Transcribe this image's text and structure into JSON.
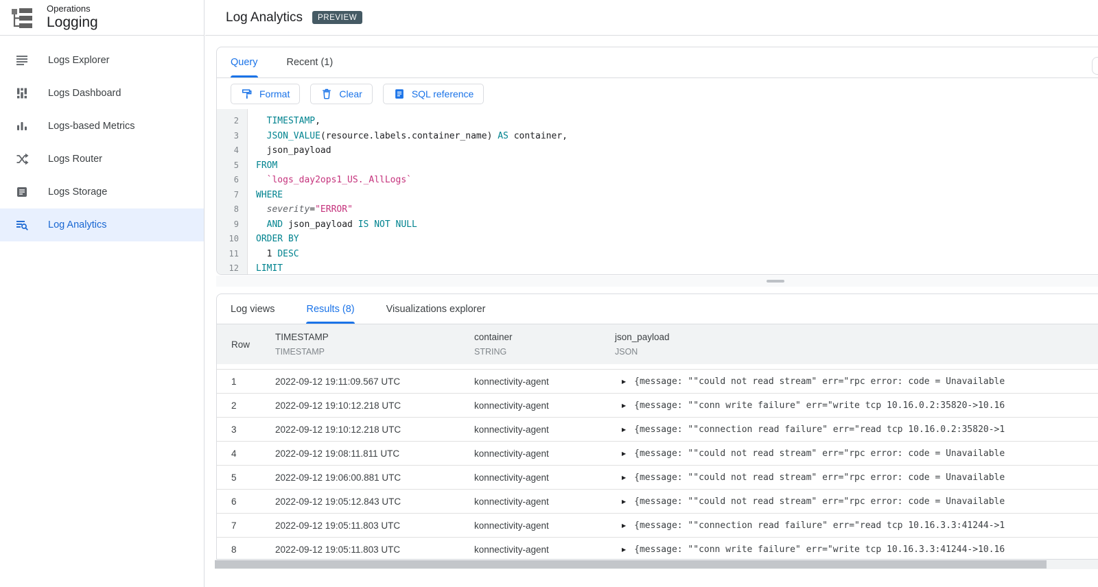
{
  "header": {
    "product": "Operations",
    "section": "Logging",
    "title": "Log Analytics",
    "badge": "PREVIEW"
  },
  "sidebar": {
    "items": [
      {
        "label": "Logs Explorer",
        "icon": "logs-explorer-icon",
        "selected": false
      },
      {
        "label": "Logs Dashboard",
        "icon": "logs-dashboard-icon",
        "selected": false
      },
      {
        "label": "Logs-based Metrics",
        "icon": "logs-based-metrics-icon",
        "selected": false
      },
      {
        "label": "Logs Router",
        "icon": "logs-router-icon",
        "selected": false
      },
      {
        "label": "Logs Storage",
        "icon": "logs-storage-icon",
        "selected": false
      },
      {
        "label": "Log Analytics",
        "icon": "log-analytics-icon",
        "selected": true
      }
    ]
  },
  "query_panel": {
    "tabs": [
      {
        "label": "Query",
        "active": true
      },
      {
        "label": "Recent (1)",
        "active": false
      }
    ],
    "toolbar": [
      {
        "label": "Format",
        "icon": "format-icon"
      },
      {
        "label": "Clear",
        "icon": "clear-icon"
      },
      {
        "label": "SQL reference",
        "icon": "sql-reference-icon"
      }
    ],
    "code_lines": [
      {
        "number": "2",
        "tokens": [
          {
            "text": "  ",
            "type": "d"
          },
          {
            "text": "TIMESTAMP",
            "type": "k"
          },
          {
            "text": ",",
            "type": "d"
          }
        ]
      },
      {
        "number": "3",
        "tokens": [
          {
            "text": "  ",
            "type": "d"
          },
          {
            "text": "JSON_VALUE",
            "type": "k"
          },
          {
            "text": "(resource.labels.container_name) ",
            "type": "d"
          },
          {
            "text": "AS",
            "type": "k"
          },
          {
            "text": " container,",
            "type": "d"
          }
        ]
      },
      {
        "number": "4",
        "tokens": [
          {
            "text": "  json_payload",
            "type": "d"
          }
        ]
      },
      {
        "number": "5",
        "tokens": [
          {
            "text": "FROM",
            "type": "k"
          }
        ]
      },
      {
        "number": "6",
        "tokens": [
          {
            "text": "  ",
            "type": "d"
          },
          {
            "text": "`logs_day2ops1_US._AllLogs`",
            "type": "s"
          }
        ]
      },
      {
        "number": "7",
        "tokens": [
          {
            "text": "WHERE",
            "type": "k"
          }
        ]
      },
      {
        "number": "8",
        "tokens": [
          {
            "text": "  ",
            "type": "d"
          },
          {
            "text": "severity",
            "type": "v"
          },
          {
            "text": "=",
            "type": "d"
          },
          {
            "text": "\"ERROR\"",
            "type": "s"
          }
        ]
      },
      {
        "number": "9",
        "tokens": [
          {
            "text": "  ",
            "type": "d"
          },
          {
            "text": "AND",
            "type": "k"
          },
          {
            "text": " json_payload ",
            "type": "d"
          },
          {
            "text": "IS NOT NULL",
            "type": "k"
          }
        ]
      },
      {
        "number": "10",
        "tokens": [
          {
            "text": "ORDER BY",
            "type": "k"
          }
        ]
      },
      {
        "number": "11",
        "tokens": [
          {
            "text": "  1 ",
            "type": "d"
          },
          {
            "text": "DESC",
            "type": "k"
          }
        ]
      },
      {
        "number": "12",
        "tokens": [
          {
            "text": "LIMIT",
            "type": "k"
          }
        ]
      }
    ]
  },
  "results_panel": {
    "tabs": [
      {
        "label": "Log views",
        "active": false
      },
      {
        "label": "Results (8)",
        "active": true
      },
      {
        "label": "Visualizations explorer",
        "active": false
      }
    ],
    "table": {
      "columns": [
        {
          "name": "Row",
          "type": ""
        },
        {
          "name": "TIMESTAMP",
          "type": "TIMESTAMP"
        },
        {
          "name": "container",
          "type": "STRING"
        },
        {
          "name": "json_payload",
          "type": "JSON"
        }
      ],
      "rows": [
        {
          "row": "1",
          "timestamp": "2022-09-12 19:11:09.567 UTC",
          "container": "konnectivity-agent",
          "json_payload": "{message: \"\"could not read stream\" err=\"rpc error: code = Unavailable"
        },
        {
          "row": "2",
          "timestamp": "2022-09-12 19:10:12.218 UTC",
          "container": "konnectivity-agent",
          "json_payload": "{message: \"\"conn write failure\" err=\"write tcp 10.16.0.2:35820->10.16"
        },
        {
          "row": "3",
          "timestamp": "2022-09-12 19:10:12.218 UTC",
          "container": "konnectivity-agent",
          "json_payload": "{message: \"\"connection read failure\" err=\"read tcp 10.16.0.2:35820->1"
        },
        {
          "row": "4",
          "timestamp": "2022-09-12 19:08:11.811 UTC",
          "container": "konnectivity-agent",
          "json_payload": "{message: \"\"could not read stream\" err=\"rpc error: code = Unavailable"
        },
        {
          "row": "5",
          "timestamp": "2022-09-12 19:06:00.881 UTC",
          "container": "konnectivity-agent",
          "json_payload": "{message: \"\"could not read stream\" err=\"rpc error: code = Unavailable"
        },
        {
          "row": "6",
          "timestamp": "2022-09-12 19:05:12.843 UTC",
          "container": "konnectivity-agent",
          "json_payload": "{message: \"\"could not read stream\" err=\"rpc error: code = Unavailable"
        },
        {
          "row": "7",
          "timestamp": "2022-09-12 19:05:11.803 UTC",
          "container": "konnectivity-agent",
          "json_payload": "{message: \"\"connection read failure\" err=\"read tcp 10.16.3.3:41244->1"
        },
        {
          "row": "8",
          "timestamp": "2022-09-12 19:05:11.803 UTC",
          "container": "konnectivity-agent",
          "json_payload": "{message: \"\"conn write failure\" err=\"write tcp 10.16.3.3:41244->10.16"
        }
      ]
    }
  },
  "colors": {
    "accent": "#1a73e8",
    "selected_item_bg": "#e8f0fe",
    "selected_item_text": "#1967d2",
    "badge_bg": "#455a64",
    "sql_keyword": "#00838f",
    "sql_string": "#c5327c",
    "border": "#dadce0",
    "table_header_bg": "#f1f3f4"
  }
}
